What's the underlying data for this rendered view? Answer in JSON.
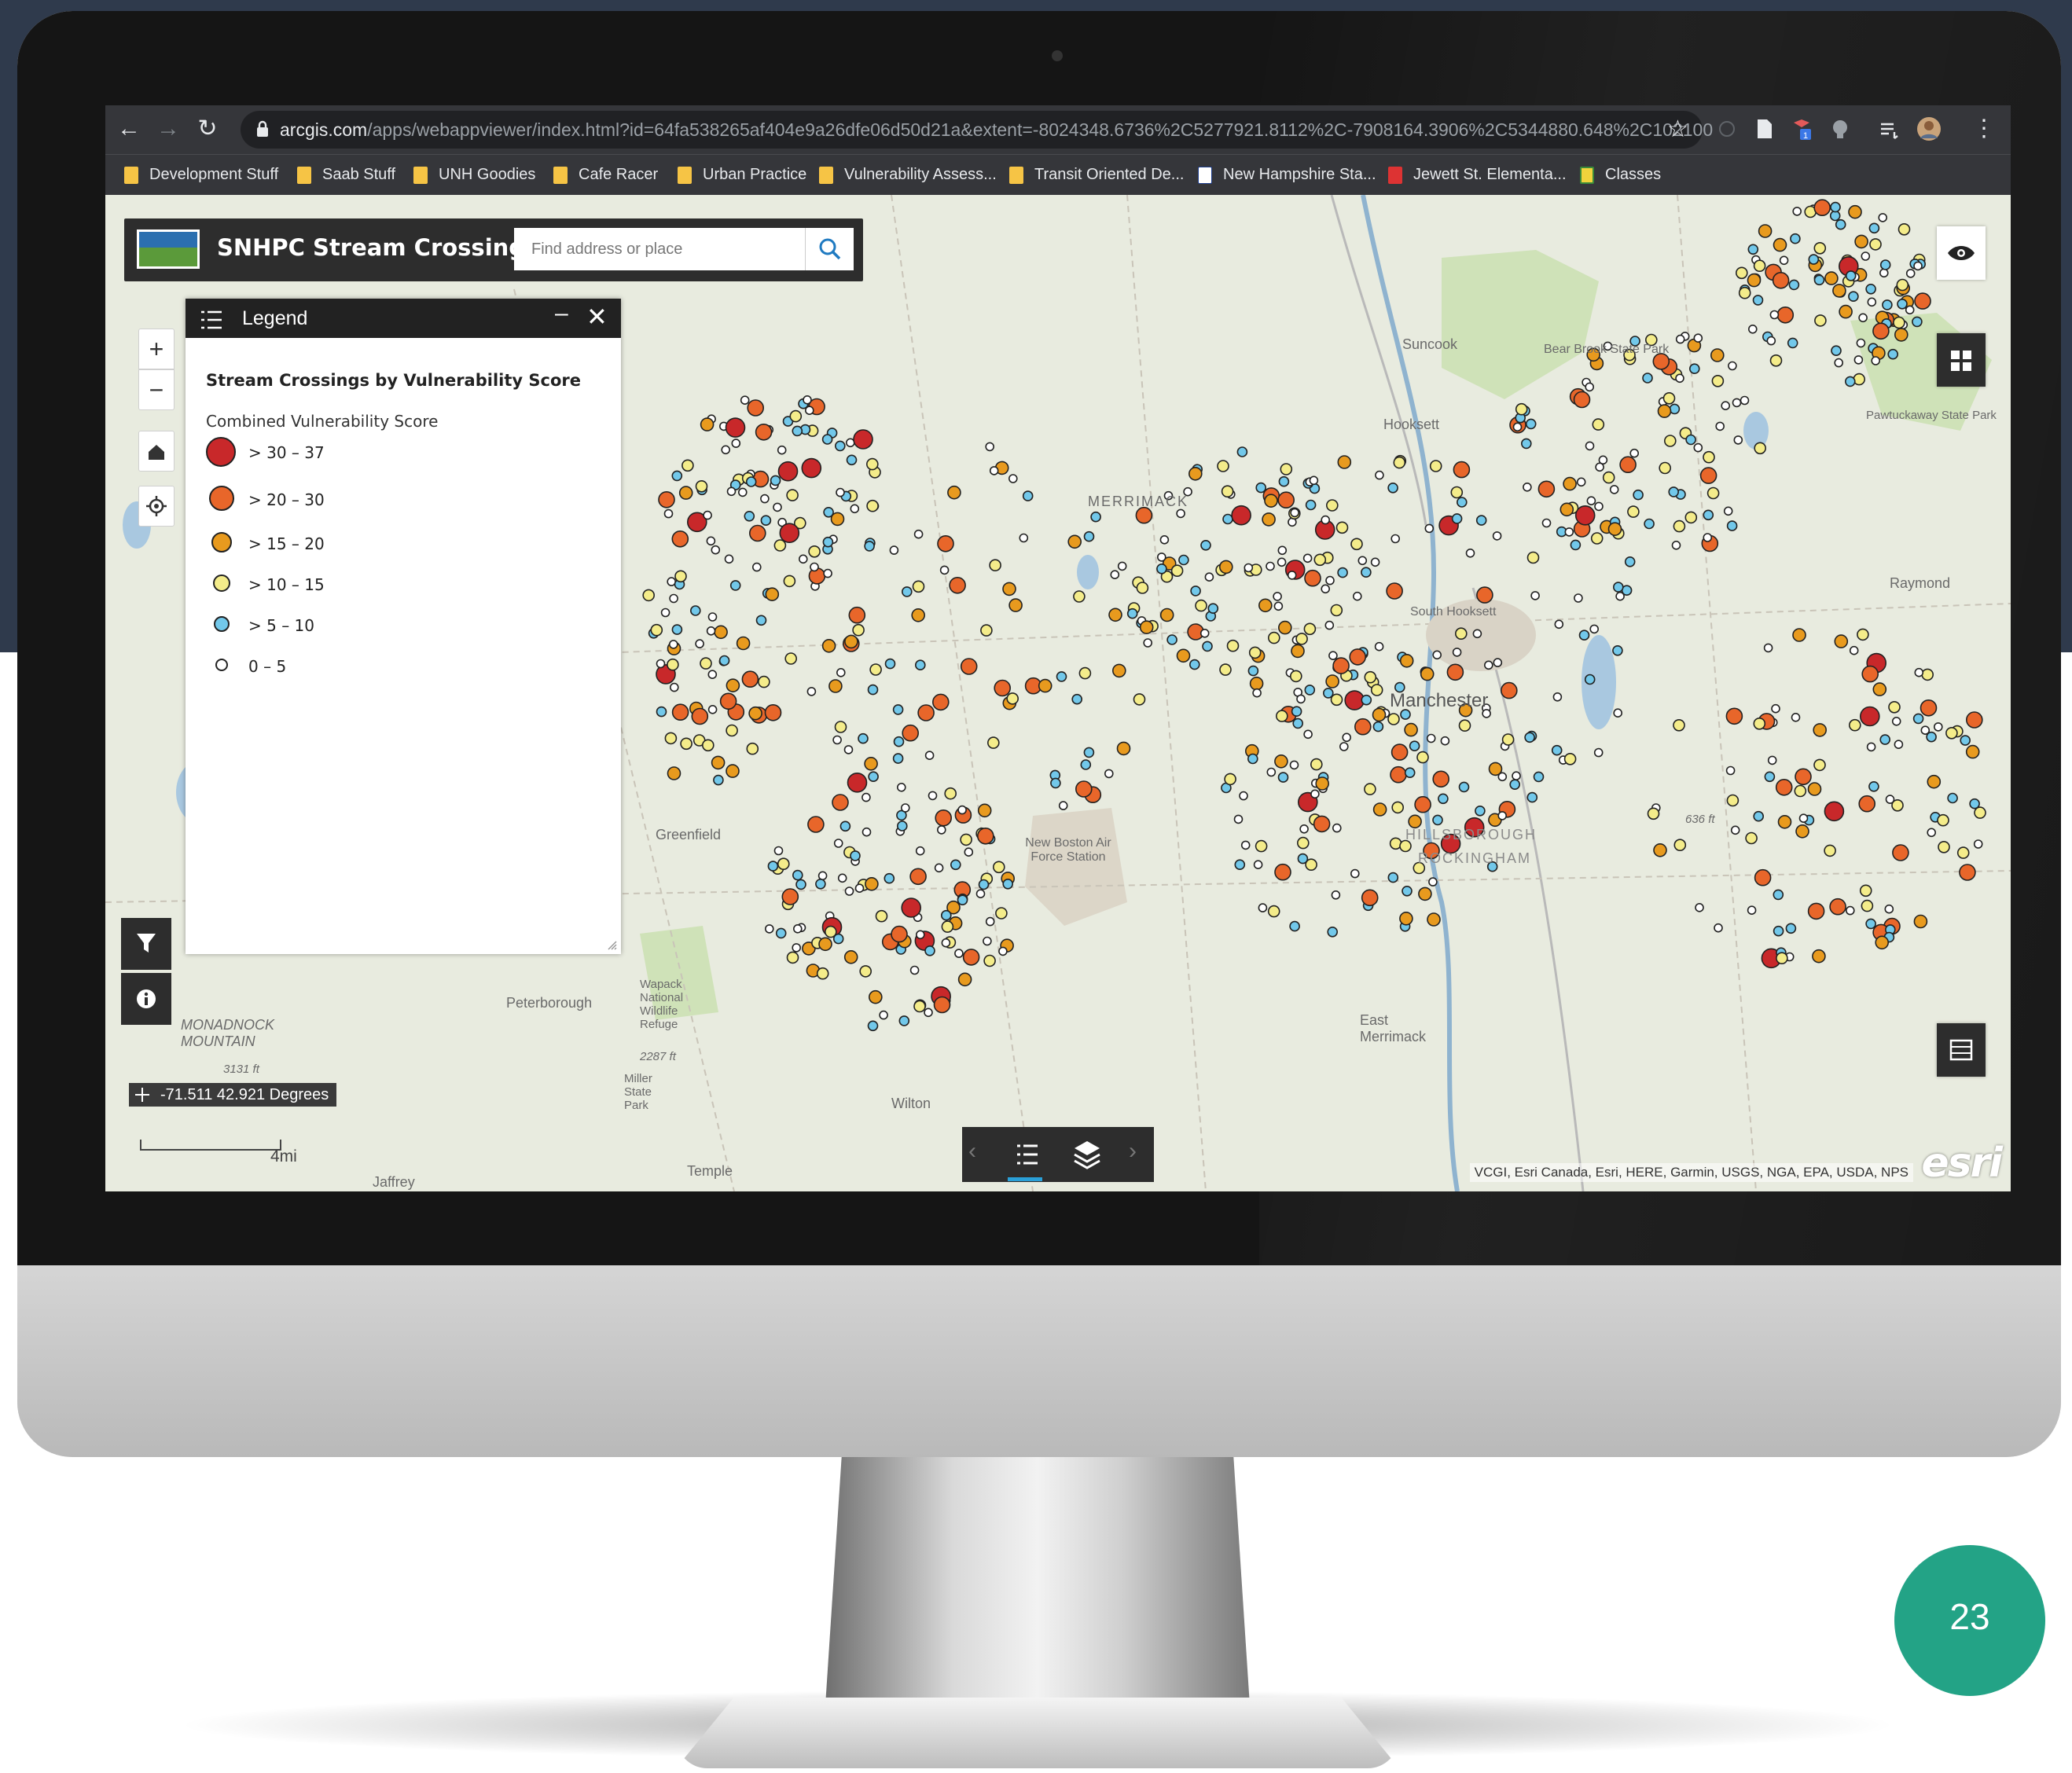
{
  "browser": {
    "url_host": "arcgis.com",
    "url_path": "/apps/webappviewer/index.html?id=64fa538265af404e9a26dfe06d50d21a&extent=-8024348.6736%2C5277921.8112%2C-7908164.3906%2C5344880.648%2C102100",
    "bookmarks": [
      "Development Stuff",
      "Saab Stuff",
      "UNH Goodies",
      "Cafe Racer",
      "Urban Practice",
      "Vulnerability Assess...",
      "Transit Oriented De...",
      "New Hampshire Sta...",
      "Jewett St. Elementa...",
      "Classes"
    ],
    "extension_badge": "1"
  },
  "app": {
    "title": "SNHPC Stream Crossings",
    "search_placeholder": "Find address or place"
  },
  "legend": {
    "title": "Legend",
    "layer_title": "Stream Crossings by Vulnerability Score",
    "field_title": "Combined Vulnerability Score",
    "classes": [
      {
        "label": "> 30 – 37",
        "color": "#c8282a",
        "size": "largest"
      },
      {
        "label": "> 20 – 30",
        "color": "#e8662a",
        "size": "large"
      },
      {
        "label": "> 15 – 20",
        "color": "#e89a1e",
        "size": "medium"
      },
      {
        "label": "> 10 – 15",
        "color": "#f4ec8a",
        "size": "small"
      },
      {
        "label": "> 5 – 10",
        "color": "#72c8ea",
        "size": "small"
      },
      {
        "label": "0 – 5",
        "color": "#ffffff",
        "size": "smallest"
      }
    ]
  },
  "map": {
    "coordinates": "-71.511 42.921 Degrees",
    "scale_label": "4mi",
    "attribution": "VCGI, Esri Canada, Esri, HERE, Garmin, USGS, NGA, EPA, USDA, NPS",
    "esri_logo": "esri",
    "places": [
      "Suncook",
      "Bear Brook State Park",
      "Hooksett",
      "MERRIMACK",
      "South Hooksett",
      "Manchester",
      "Raymond",
      "Pawtuckaway State Park",
      "Greenfield",
      "New Boston Air Force Station",
      "Peterborough",
      "Wapack National Wildlife Refuge",
      "MONADNOCK MOUNTAIN",
      "Miller State Park",
      "East Merrimack",
      "Wilton",
      "Temple",
      "Jaffrey",
      "HILLSBOROUGH",
      "ROCKINGHAM",
      "636 ft",
      "2287 ft",
      "3131 ft"
    ]
  },
  "slide": {
    "page_number": "23"
  },
  "colors": {
    "map_background": "#e8ebdf",
    "water": "#a9c8e0",
    "forest": "#cfe2b8",
    "badge": "#23a386"
  }
}
